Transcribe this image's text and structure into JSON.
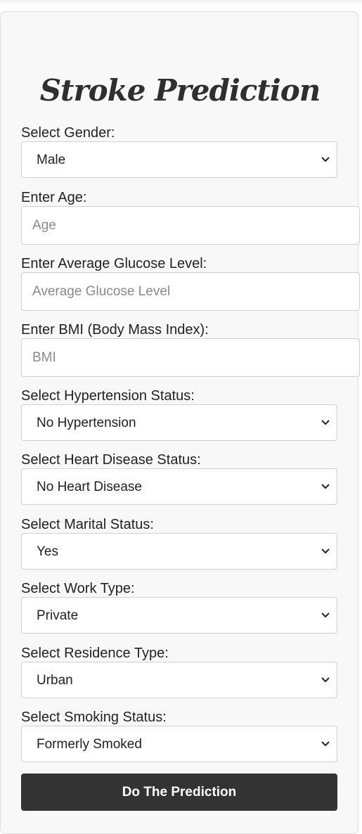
{
  "form": {
    "title": "Stroke Prediction",
    "gender": {
      "label": "Select Gender:",
      "value": "Male"
    },
    "age": {
      "label": "Enter Age:",
      "placeholder": "Age",
      "value": ""
    },
    "glucose": {
      "label": "Enter Average Glucose Level:",
      "placeholder": "Average Glucose Level",
      "value": ""
    },
    "bmi": {
      "label": "Enter BMI (Body Mass Index):",
      "placeholder": "BMI",
      "value": ""
    },
    "hypertension": {
      "label": "Select Hypertension Status:",
      "value": "No Hypertension"
    },
    "heart_disease": {
      "label": "Select Heart Disease Status:",
      "value": "No Heart Disease"
    },
    "marital": {
      "label": "Select Marital Status:",
      "value": "Yes"
    },
    "work_type": {
      "label": "Select Work Type:",
      "value": "Private"
    },
    "residence": {
      "label": "Select Residence Type:",
      "value": "Urban"
    },
    "smoking": {
      "label": "Select Smoking Status:",
      "value": "Formerly Smoked"
    },
    "submit_label": "Do The Prediction"
  },
  "icons": {
    "select_arrow": "chevron-down-icon"
  },
  "colors": {
    "button_bg": "#333333",
    "card_bg": "#f8f8f8",
    "title": "#2f2f2f"
  }
}
